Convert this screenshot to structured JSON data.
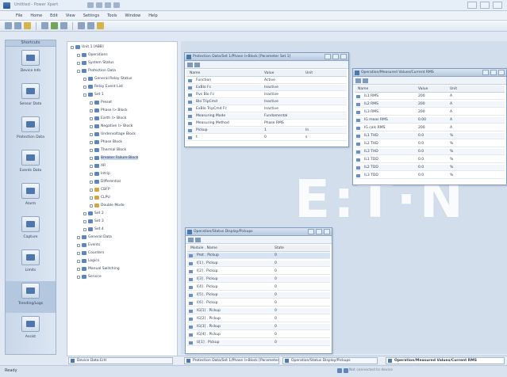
{
  "window": {
    "title": "Untitled - Power Xpert"
  },
  "menu": [
    "File",
    "Home",
    "Edit",
    "View",
    "Settings",
    "Tools",
    "Window",
    "Help"
  ],
  "statusbar": {
    "text": "Ready",
    "right": "Not connected to device"
  },
  "leftbar": {
    "header": "Shortcuts",
    "items": [
      "Device Info",
      "Sensor Data",
      "Protection Data",
      "Events Data",
      "Alarm",
      "Capture",
      "Limits",
      "Trending/Logs",
      "Assist"
    ]
  },
  "tree": [
    {
      "label": "Unit 1 [ABB]",
      "level": 0,
      "color": "blue"
    },
    {
      "label": "Operations",
      "level": 1,
      "color": "blue"
    },
    {
      "label": "System Status",
      "level": 1,
      "color": "blue"
    },
    {
      "label": "Protection Data",
      "level": 1,
      "color": "blue"
    },
    {
      "label": "General Relay Status",
      "level": 2,
      "color": "blue"
    },
    {
      "label": "Relay Event List",
      "level": 2,
      "color": "blue"
    },
    {
      "label": "Set 1",
      "level": 2,
      "color": "blue"
    },
    {
      "label": "Preset",
      "level": 3,
      "color": "blue"
    },
    {
      "label": "Phase I> Block",
      "level": 3,
      "color": "blue"
    },
    {
      "label": "Earth I> Block",
      "level": 3,
      "color": "blue"
    },
    {
      "label": "Negative I> Block",
      "level": 3,
      "color": "blue"
    },
    {
      "label": "Undervoltage Block",
      "level": 3,
      "color": "blue"
    },
    {
      "label": "Phase Block",
      "level": 3,
      "color": "blue"
    },
    {
      "label": "Thermal Block",
      "level": 3,
      "color": "blue"
    },
    {
      "label": "Breaker Failure Block",
      "level": 3,
      "color": "blue",
      "selected": true
    },
    {
      "label": "AR",
      "level": 3,
      "color": "blue"
    },
    {
      "label": "Intrip",
      "level": 3,
      "color": "blue"
    },
    {
      "label": "Differential",
      "level": 3,
      "color": "blue"
    },
    {
      "label": "CBFP",
      "level": 3,
      "color": "yellow"
    },
    {
      "label": "CLPU",
      "level": 3,
      "color": "yellow"
    },
    {
      "label": "Double Mode",
      "level": 3,
      "color": "yellow"
    },
    {
      "label": "Set 2",
      "level": 2,
      "color": "blue"
    },
    {
      "label": "Set 3",
      "level": 2,
      "color": "blue"
    },
    {
      "label": "Set 4",
      "level": 2,
      "color": "blue"
    },
    {
      "label": "General Data",
      "level": 1,
      "color": "blue"
    },
    {
      "label": "Events",
      "level": 1,
      "color": "blue"
    },
    {
      "label": "Counters",
      "level": 1,
      "color": "blue"
    },
    {
      "label": "Logics",
      "level": 1,
      "color": "blue"
    },
    {
      "label": "Manual Switching",
      "level": 1,
      "color": "blue"
    },
    {
      "label": "Service",
      "level": 1,
      "color": "blue"
    }
  ],
  "win1": {
    "title": "Protection Data/Set 1/Phase I>Block [Parameter Set 1]",
    "headers": [
      "Name",
      "Value",
      "Unit"
    ],
    "rows": [
      {
        "name": "Function",
        "value": "Active",
        "unit": ""
      },
      {
        "name": "ExBlo Fc",
        "value": "Inactive",
        "unit": ""
      },
      {
        "name": "Rvs Blo Fc",
        "value": "Inactive",
        "unit": ""
      },
      {
        "name": "Blo TripCmd",
        "value": "Inactive",
        "unit": ""
      },
      {
        "name": "ExBlo TripCmd Fc",
        "value": "Inactive",
        "unit": ""
      },
      {
        "name": "Measuring Mode",
        "value": "Fundamental",
        "unit": ""
      },
      {
        "name": "Measuring Method",
        "value": "Phase RMS",
        "unit": ""
      },
      {
        "name": "Pickup",
        "value": "1",
        "unit": "In"
      },
      {
        "name": "t",
        "value": "0",
        "unit": "s"
      }
    ]
  },
  "win2": {
    "title": "Operation/Measured Values/Current RMS",
    "headers": [
      "Name",
      "Value",
      "Unit"
    ],
    "rows": [
      {
        "name": "IL1 RMS",
        "value": "200",
        "unit": "A"
      },
      {
        "name": "IL2 RMS",
        "value": "200",
        "unit": "A"
      },
      {
        "name": "IL3 RMS",
        "value": "200",
        "unit": "A"
      },
      {
        "name": "IG meas RMS",
        "value": "0.00",
        "unit": "A"
      },
      {
        "name": "IG calc RMS",
        "value": "200",
        "unit": "A"
      },
      {
        "name": "IL1 THD",
        "value": "0.0",
        "unit": "%"
      },
      {
        "name": "IL2 THD",
        "value": "0.0",
        "unit": "%"
      },
      {
        "name": "IL3 THD",
        "value": "0.0",
        "unit": "%"
      },
      {
        "name": "IL1 TDD",
        "value": "0.0",
        "unit": "%"
      },
      {
        "name": "IL2 TDD",
        "value": "0.0",
        "unit": "%"
      },
      {
        "name": "IL3 TDD",
        "value": "0.0",
        "unit": "%"
      }
    ]
  },
  "win3": {
    "title": "Operation/Status Display/Pickups",
    "headers": [
      "Module . Name",
      "State"
    ],
    "rows": [
      {
        "name": "Prot . Pickup",
        "value": "0"
      },
      {
        "name": "I[1] . Pickup",
        "value": "0"
      },
      {
        "name": "I[2] . Pickup",
        "value": "0"
      },
      {
        "name": "I[3] . Pickup",
        "value": "0"
      },
      {
        "name": "I[4] . Pickup",
        "value": "0"
      },
      {
        "name": "I[5] . Pickup",
        "value": "0"
      },
      {
        "name": "I[6] . Pickup",
        "value": "0"
      },
      {
        "name": "IG[1] . Pickup",
        "value": "0"
      },
      {
        "name": "IG[2] . Pickup",
        "value": "0"
      },
      {
        "name": "IG[3] . Pickup",
        "value": "0"
      },
      {
        "name": "IG[4] . Pickup",
        "value": "0"
      },
      {
        "name": "U[1] . Pickup",
        "value": "0"
      }
    ]
  },
  "logo": {
    "text": "E:T·N"
  },
  "taskbar": [
    {
      "label": "Device Data.ErH",
      "active": false
    },
    {
      "label": "Protection Data/Set 1/Phase I>Block [Parameter Set 1]",
      "active": false
    },
    {
      "label": "Operation/Status Display/Pickups",
      "active": false
    },
    {
      "label": "Operation/Measured Values/Current RMS",
      "active": true
    }
  ],
  "colors": {
    "accent": "#4d77ad",
    "workspace": "#d3deec",
    "logo": "#ffffff"
  }
}
